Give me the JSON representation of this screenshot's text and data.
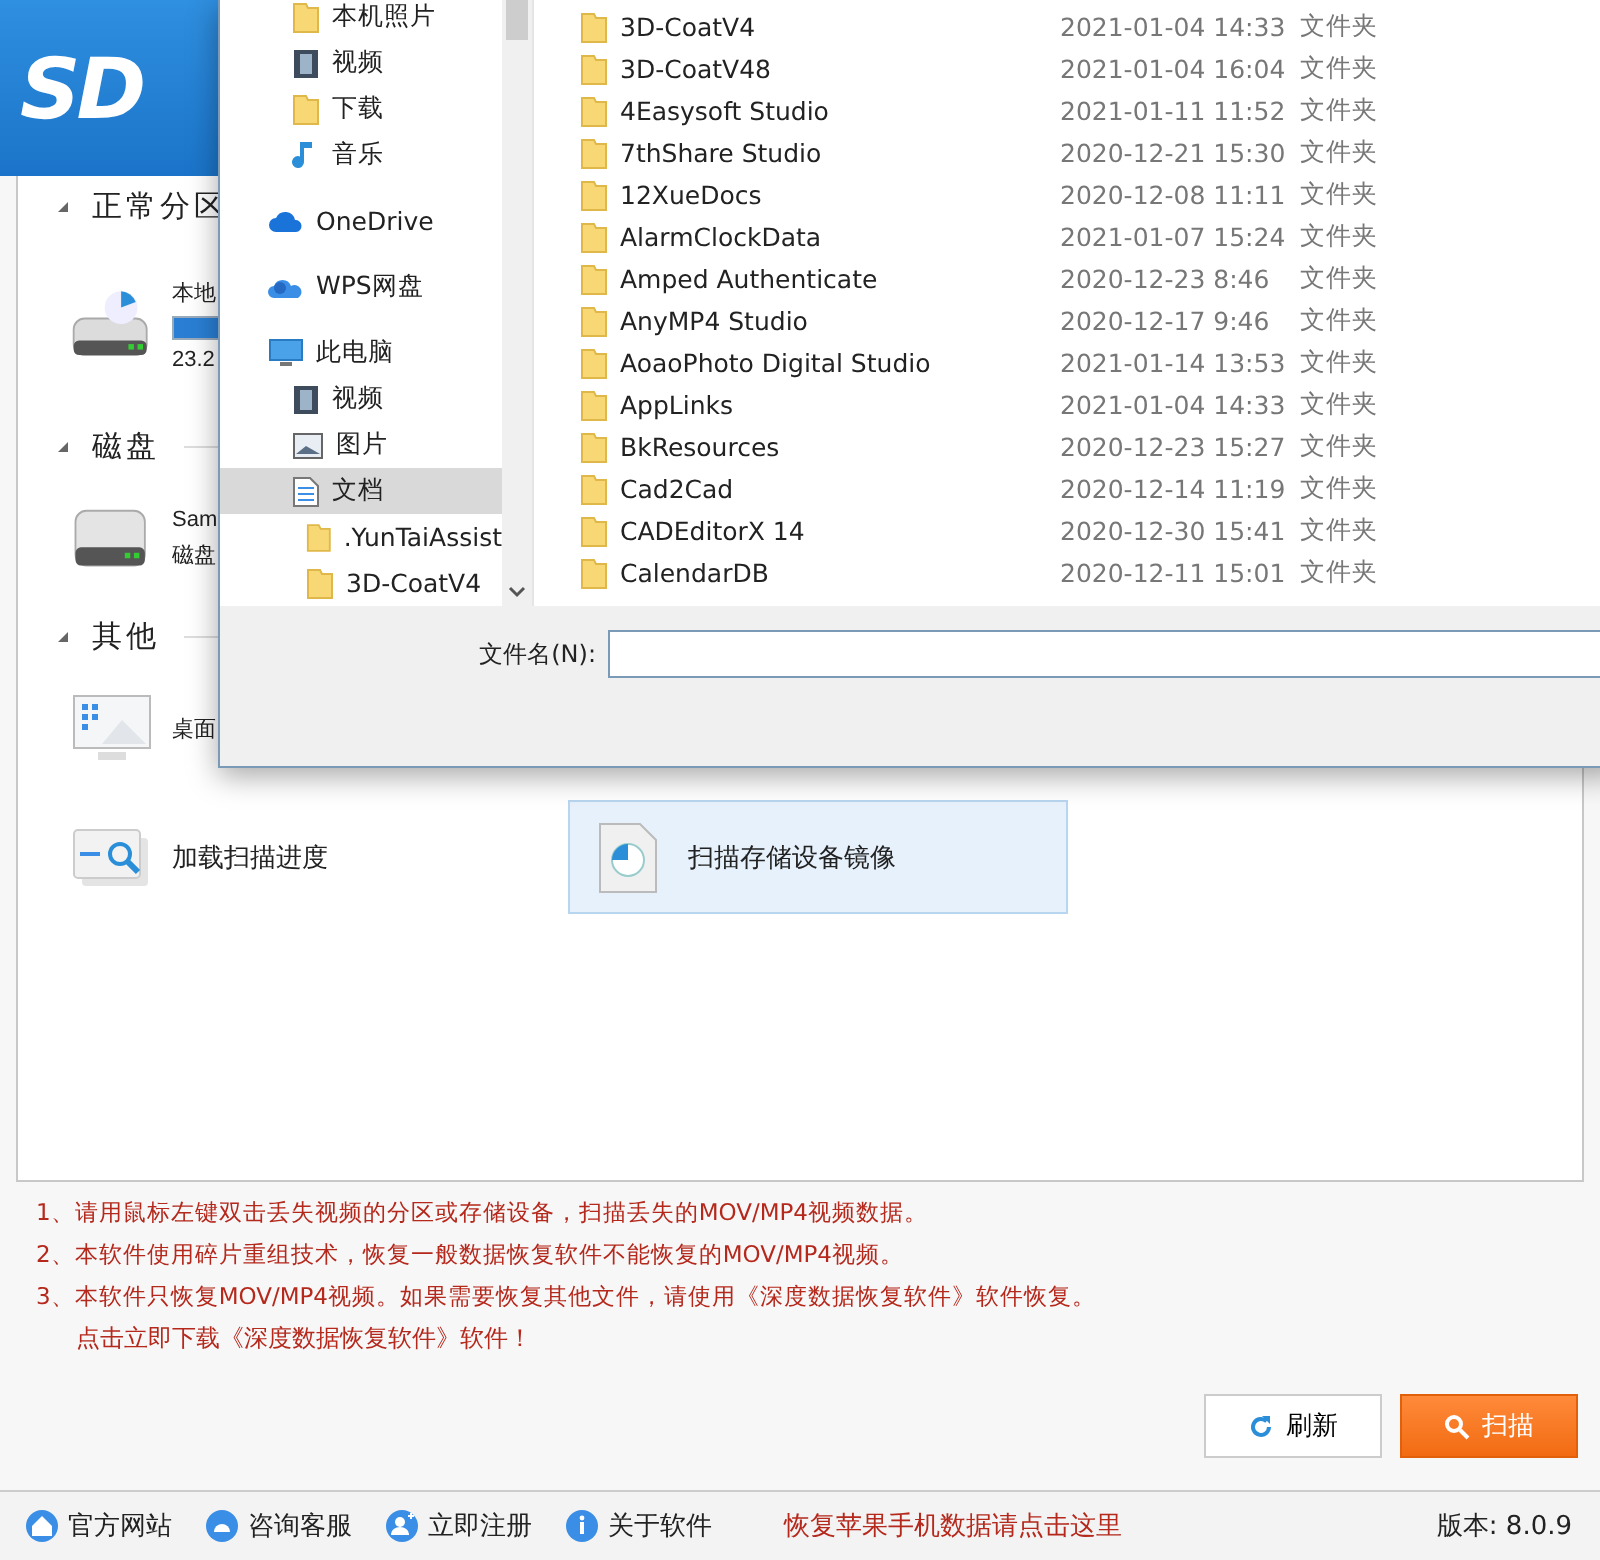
{
  "header": {
    "logo": "SD"
  },
  "sections": [
    {
      "title": "正常分区",
      "items": [
        {
          "kind": "drive",
          "name": "本地",
          "detail": "23.2",
          "selected": false
        }
      ]
    },
    {
      "title": "磁盘",
      "items": [
        {
          "kind": "disk",
          "name": "Sam",
          "detail": "磁盘",
          "selected": false
        }
      ]
    },
    {
      "title": "其他",
      "items": [
        {
          "kind": "desktop",
          "name": "桌面",
          "selected": false
        },
        {
          "kind": "load",
          "name": "加载扫描进度",
          "selected": false
        },
        {
          "kind": "image",
          "name": "扫描存储设备镜像",
          "selected": true
        }
      ]
    }
  ],
  "dialog": {
    "nav": {
      "quick_access_children": [
        {
          "kind": "folder",
          "label": "本机照片",
          "selected": false
        },
        {
          "kind": "video",
          "label": "视频",
          "selected": false
        },
        {
          "kind": "folder",
          "label": "下载",
          "selected": false
        },
        {
          "kind": "music",
          "label": "音乐",
          "selected": false
        }
      ],
      "tree": [
        {
          "kind": "cloud",
          "label": "OneDrive",
          "selected": false
        },
        {
          "kind": "wps",
          "label": "WPS网盘",
          "selected": false
        },
        {
          "kind": "pc",
          "label": "此电脑",
          "selected": false,
          "children": [
            {
              "kind": "video",
              "label": "视频",
              "selected": false
            },
            {
              "kind": "picture",
              "label": "图片",
              "selected": false
            },
            {
              "kind": "document",
              "label": "文档",
              "selected": true,
              "children": [
                {
                  "kind": "folder",
                  "label": ".YunTaiAssist",
                  "selected": false
                },
                {
                  "kind": "folder",
                  "label": "3D-CoatV4",
                  "selected": false
                }
              ]
            }
          ]
        }
      ]
    },
    "files": [
      {
        "name": "3D-CoatV4",
        "modified": "2021-01-04 14:33",
        "type": "文件夹"
      },
      {
        "name": "3D-CoatV48",
        "modified": "2021-01-04 16:04",
        "type": "文件夹"
      },
      {
        "name": "4Easysoft Studio",
        "modified": "2021-01-11 11:52",
        "type": "文件夹"
      },
      {
        "name": "7thShare Studio",
        "modified": "2020-12-21 15:30",
        "type": "文件夹"
      },
      {
        "name": "12XueDocs",
        "modified": "2020-12-08 11:11",
        "type": "文件夹"
      },
      {
        "name": "AlarmClockData",
        "modified": "2021-01-07 15:24",
        "type": "文件夹"
      },
      {
        "name": "Amped Authenticate",
        "modified": "2020-12-23 8:46",
        "type": "文件夹"
      },
      {
        "name": "AnyMP4 Studio",
        "modified": "2020-12-17 9:46",
        "type": "文件夹"
      },
      {
        "name": "AoaoPhoto Digital Studio",
        "modified": "2021-01-14 13:53",
        "type": "文件夹"
      },
      {
        "name": "AppLinks",
        "modified": "2021-01-04 14:33",
        "type": "文件夹"
      },
      {
        "name": "BkResources",
        "modified": "2020-12-23 15:27",
        "type": "文件夹"
      },
      {
        "name": "Cad2Cad",
        "modified": "2020-12-14 11:19",
        "type": "文件夹"
      },
      {
        "name": "CADEditorX 14",
        "modified": "2020-12-30 15:41",
        "type": "文件夹"
      },
      {
        "name": "CalendarDB",
        "modified": "2020-12-11 15:01",
        "type": "文件夹"
      }
    ],
    "filename": {
      "label": "文件名(N):"
    }
  },
  "notes": [
    {
      "kind": "note",
      "text": "1、请用鼠标左键双击丢失视频的分区或存储设备，扫描丢失的MOV/MP4视频数据。"
    },
    {
      "kind": "note",
      "text": "2、本软件使用碎片重组技术，恢复一般数据恢复软件不能恢复的MOV/MP4视频。"
    },
    {
      "kind": "note",
      "text": "3、本软件只恢复MOV/MP4视频。如果需要恢复其他文件，请使用《深度数据恢复软件》软件恢复。"
    },
    {
      "kind": "link",
      "text": "点击立即下载《深度数据恢复软件》软件！"
    }
  ],
  "buttons": [
    {
      "kind": "refresh",
      "label": "刷新"
    },
    {
      "kind": "scan",
      "label": "扫描"
    }
  ],
  "status_bar": {
    "links": [
      {
        "kind": "home",
        "label": "官方网站"
      },
      {
        "kind": "service",
        "label": "咨询客服"
      },
      {
        "kind": "register",
        "label": "立即注册"
      },
      {
        "kind": "about",
        "label": "关于软件"
      }
    ],
    "promo": "恢复苹果手机数据请点击这里",
    "version": "版本: 8.0.9"
  }
}
